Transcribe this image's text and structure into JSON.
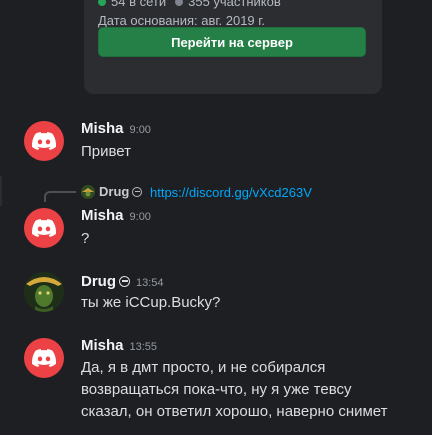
{
  "invite": {
    "online_count": "54 в сети",
    "member_count": "355 участников",
    "founded": "Дата основания: авг. 2019 г.",
    "join_label": "Перейти на сервер"
  },
  "messages": [
    {
      "author": "Misha",
      "time": "9:00",
      "text": "Привет",
      "avatar": "discord-logo-icon"
    },
    {
      "reply": {
        "author": "Drug",
        "text": "https://discord.gg/vXcd263V"
      },
      "author": "Misha",
      "time": "9:00",
      "text": "?",
      "avatar": "discord-logo-icon"
    },
    {
      "author": "Drug",
      "time": "13:54",
      "text": "ты же iCCup.Bucky?",
      "avatar": "user-avatar"
    },
    {
      "author": "Misha",
      "time": "13:55",
      "text": "Да, я в дмт просто, и не собирался возвращаться пока-что, ну я уже тевсу сказал, он ответил хорошо, наверно снимет",
      "avatar": "discord-logo-icon"
    }
  ],
  "colors": {
    "background": "#1e1f22",
    "card": "#2b2d31",
    "join_button": "#248046",
    "link": "#00a8fc",
    "avatar_red": "#ed4245",
    "online": "#23a55a"
  }
}
